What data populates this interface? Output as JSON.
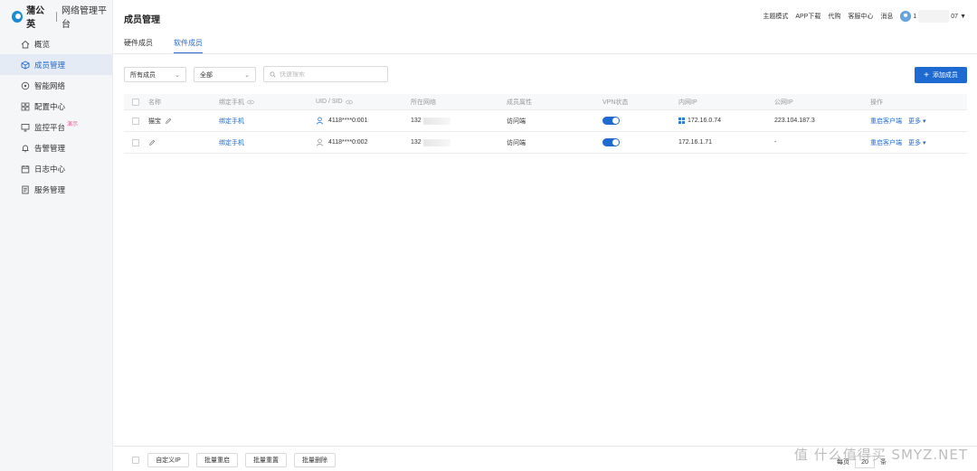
{
  "brand": {
    "name": "蒲公英",
    "subtitle": "网络管理平台",
    "color": "#1a8bd6"
  },
  "sidebar": {
    "items": [
      {
        "label": "概览",
        "icon": "home-icon",
        "active": false
      },
      {
        "label": "成员管理",
        "icon": "cube-icon",
        "active": true
      },
      {
        "label": "智能网络",
        "icon": "network-icon",
        "active": false
      },
      {
        "label": "配置中心",
        "icon": "grid-icon",
        "active": false
      },
      {
        "label": "监控平台",
        "icon": "monitor-icon",
        "active": false,
        "badge": "演示"
      },
      {
        "label": "告警管理",
        "icon": "bell-icon",
        "active": false
      },
      {
        "label": "日志中心",
        "icon": "calendar-icon",
        "active": false
      },
      {
        "label": "服务管理",
        "icon": "document-icon",
        "active": false
      }
    ]
  },
  "header": {
    "title": "成员管理",
    "links": [
      "主题模式",
      "APP下载",
      "代购",
      "客服中心",
      "消息"
    ],
    "user_prefix": "1",
    "user_suffix": "07"
  },
  "tabs": [
    {
      "label": "硬件成员",
      "active": false
    },
    {
      "label": "软件成员",
      "active": true
    }
  ],
  "filters": {
    "member_type": "所有成员",
    "scope": "全部",
    "search_placeholder": "快速搜索",
    "search_value": ""
  },
  "add_button": {
    "label": "添加成员",
    "icon": "plus-icon"
  },
  "table": {
    "columns": [
      "名称",
      "绑定手机",
      "UID / SID",
      "所在网络",
      "成员属性",
      "VPN状态",
      "内网IP",
      "公网IP",
      "操作"
    ],
    "rows": [
      {
        "name": "猫宝",
        "phone": "绑定手机",
        "uid": "4118****0:001",
        "network": "132",
        "attribute": "访问端",
        "vpn_on": true,
        "lan_ip": "172.16.0.74",
        "lan_os": "windows-icon",
        "wan_ip": "223.104.187.3",
        "action": "重启客户端",
        "more": "更多"
      },
      {
        "name": "",
        "phone": "绑定手机",
        "uid": "4118****0:002",
        "network": "132",
        "attribute": "访问端",
        "vpn_on": true,
        "lan_ip": "172.16.1.71",
        "lan_os": "",
        "wan_ip": "-",
        "action": "重启客户端",
        "more": "更多"
      }
    ]
  },
  "footer": {
    "buttons": [
      "自定义IP",
      "批量重启",
      "批量重置",
      "批量删除"
    ],
    "per_page_label": "每页",
    "per_page_value": "20",
    "per_page_unit": "条"
  },
  "watermark": "值 什么值得买 SMYZ.NET",
  "colors": {
    "primary": "#1f6ad1",
    "demo_badge": "#e85a9a"
  }
}
